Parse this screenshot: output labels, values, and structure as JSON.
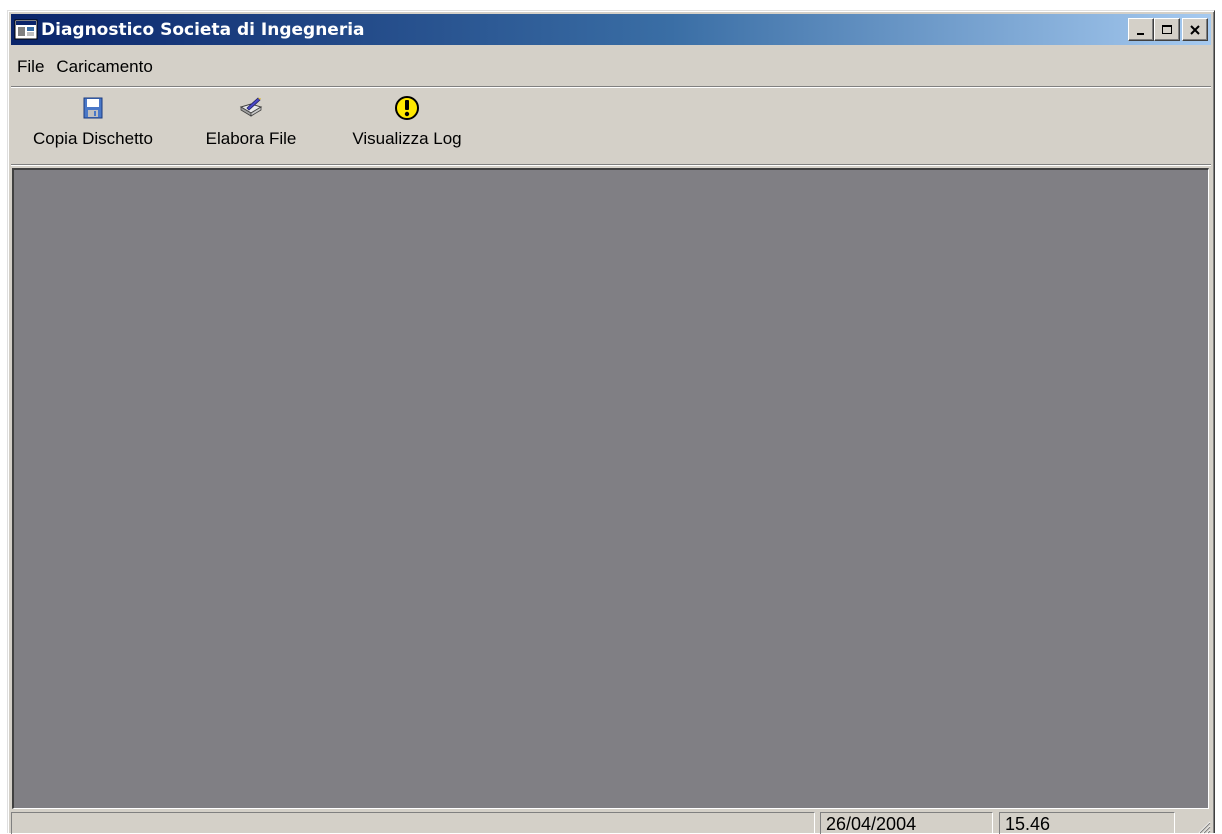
{
  "window": {
    "title": "Diagnostico Societa di Ingegneria",
    "icon": "app-window-icon",
    "caption_buttons": [
      {
        "name": "minimize",
        "glyph": "_"
      },
      {
        "name": "maximize",
        "glyph": "□"
      },
      {
        "name": "close",
        "glyph": "×"
      }
    ]
  },
  "menubar": {
    "items": [
      {
        "label": "File"
      },
      {
        "label": "Caricamento"
      }
    ]
  },
  "toolbar": {
    "buttons": [
      {
        "label": "Copia Dischetto",
        "icon": "floppy-disk-icon"
      },
      {
        "label": "Elabora File",
        "icon": "edit-document-icon"
      },
      {
        "label": "Visualizza Log",
        "icon": "warning-icon"
      }
    ]
  },
  "statusbar": {
    "panels": [
      {
        "text": ""
      },
      {
        "text": "26/04/2004"
      },
      {
        "text": "15.46"
      }
    ]
  },
  "colors": {
    "title_gradient_start": "#0a246a",
    "title_gradient_end": "#a6caf0",
    "face": "#d4d0c8",
    "client_area": "#807f84",
    "warning_yellow": "#ffe800"
  }
}
